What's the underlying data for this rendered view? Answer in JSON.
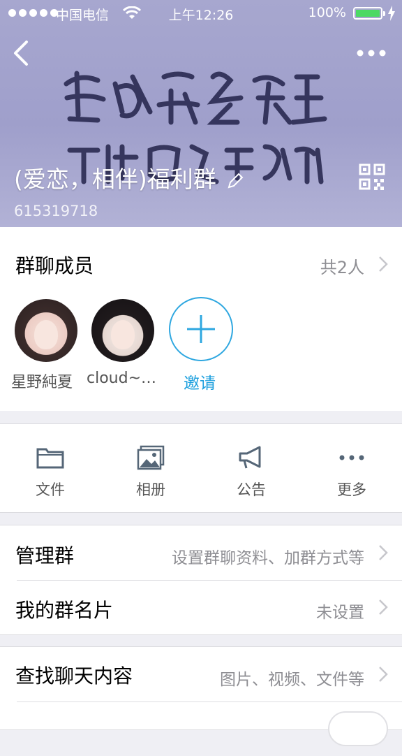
{
  "status_bar": {
    "carrier": "中国电信",
    "time": "上午12:26",
    "battery": "100%"
  },
  "header": {
    "group_name": "(爱恋，相伴)福利群",
    "group_id": "615319718"
  },
  "members": {
    "title": "群聊成员",
    "count": "共2人",
    "list": [
      {
        "name": "星野純夏"
      },
      {
        "name": "cloud~…"
      }
    ],
    "invite_label": "邀请"
  },
  "tools": [
    {
      "label": "文件",
      "icon": "folder-icon"
    },
    {
      "label": "相册",
      "icon": "album-icon"
    },
    {
      "label": "公告",
      "icon": "megaphone-icon"
    },
    {
      "label": "更多",
      "icon": "more-icon"
    }
  ],
  "settings": {
    "manage": {
      "title": "管理群",
      "value": "设置群聊资料、加群方式等"
    },
    "card": {
      "title": "我的群名片",
      "value": "未设置"
    },
    "search": {
      "title": "查找聊天内容",
      "value": "图片、视频、文件等"
    }
  },
  "colors": {
    "accent": "#2ea7e0",
    "header_bg": "#a3a3cd",
    "battery": "#4cd964"
  }
}
